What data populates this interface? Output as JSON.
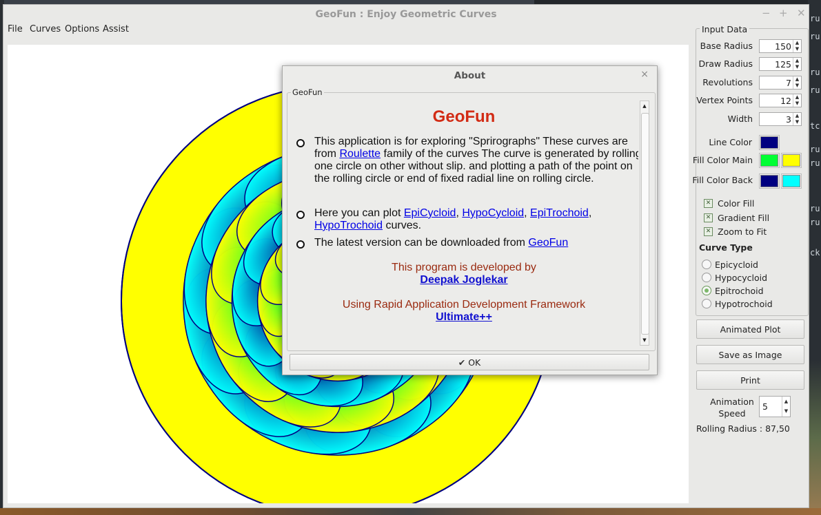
{
  "window": {
    "title": "GeoFun : Enjoy Geometric Curves",
    "min_glyph": "−",
    "max_glyph": "+",
    "close_glyph": "✕"
  },
  "menu": [
    "File",
    "Curves",
    "Options",
    "Assist"
  ],
  "input_data": {
    "title": "Input Data",
    "fields": [
      {
        "label": "Base Radius",
        "value": "150"
      },
      {
        "label": "Draw Radius",
        "value": "125"
      },
      {
        "label": "Revolutions",
        "value": "7"
      },
      {
        "label": "Vertex Points",
        "value": "12"
      },
      {
        "label": "Width",
        "value": "3"
      }
    ],
    "line_color_label": "Line Color",
    "fill_main_label": "Fill Color Main",
    "fill_back_label": "Fill Color Back",
    "colors": {
      "line": "#000080",
      "fill_main_1": "#00ff33",
      "fill_main_2": "#ffff00",
      "fill_back_1": "#000080",
      "fill_back_2": "#00ffff"
    },
    "checkboxes": [
      {
        "label": "Color Fill",
        "checked": true
      },
      {
        "label": "Gradient Fill",
        "checked": true
      },
      {
        "label": "Zoom to Fit",
        "checked": true
      }
    ],
    "curve_type_title": "Curve Type",
    "curve_types": [
      {
        "label": "Epicycloid",
        "selected": false
      },
      {
        "label": "Hypocycloid",
        "selected": false
      },
      {
        "label": "Epitrochoid",
        "selected": true
      },
      {
        "label": "Hypotrochoid",
        "selected": false
      }
    ]
  },
  "buttons": {
    "animated_plot": "Animated Plot",
    "save_image": "Save as Image",
    "print": "Print"
  },
  "animation": {
    "label_1": "Animation",
    "label_2": "Speed",
    "value": "5"
  },
  "rolling_radius": "Rolling Radius : 87,50",
  "about": {
    "title": "About",
    "group_label": "GeoFun",
    "heading": "GeoFun",
    "p1_a": "This application is for exploring \"Sprirographs\"  These curves are from ",
    "p1_link": "Roulette",
    "p1_b": "  family of the curves The curve is generated by rolling one circle on other without slip. and plotting a path of the point on the rolling circle or end of fixed radial line on rolling circle.",
    "p2_a": "Here you can plot ",
    "p2_links": [
      "EpiCycloid",
      "HypoCycloid",
      "EpiTrochoid",
      "HypoTrochoid"
    ],
    "p2_sep": ", ",
    "p2_b": " curves.",
    "p3_a": "The latest version can be downloaded from ",
    "p3_link": "GeoFun",
    "dev_line": "This program is developed by",
    "dev_name": "Deepak Joglekar",
    "fw_line": "Using Rapid Application Development Framework",
    "fw_name": "Ultimate++",
    "ok": "OK",
    "close_glyph": "×"
  },
  "background_text": [
    "ru",
    "ru",
    "ru",
    "ru",
    "tc",
    "ru",
    "ru",
    "ru",
    "ru",
    "ck"
  ]
}
